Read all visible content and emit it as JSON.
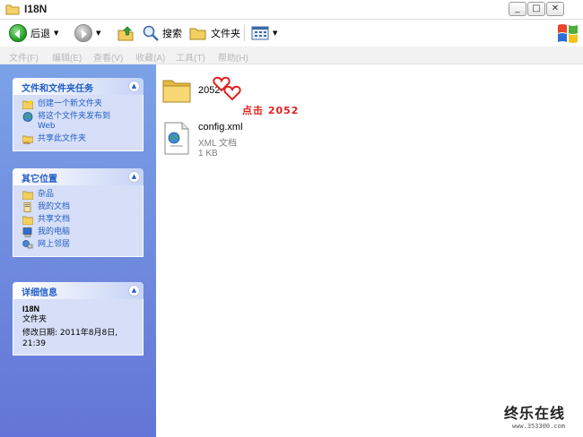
{
  "window": {
    "title": "I18N",
    "controls": {
      "minimize": "_",
      "maximize": "□",
      "close": "✕"
    }
  },
  "toolbar": {
    "back_label": "后退",
    "search_label": "搜索",
    "folders_label": "文件夹"
  },
  "menu": {
    "items": [
      "文件(F)",
      "编辑(E)",
      "查看(V)",
      "收藏(A)",
      "工具(T)",
      "帮助(H)"
    ]
  },
  "left_pane": {
    "tasks": {
      "title": "文件和文件夹任务",
      "items": [
        {
          "icon": "new-folder-icon",
          "label": "创建一个新文件夹"
        },
        {
          "icon": "globe-publish-icon",
          "label": "将这个文件夹发布到",
          "label2": "Web"
        },
        {
          "icon": "share-folder-icon",
          "label": "共享此文件夹"
        }
      ]
    },
    "places": {
      "title": "其它位置",
      "items": [
        {
          "icon": "folder-icon",
          "label": "杂品"
        },
        {
          "icon": "my-documents-icon",
          "label": "我的文档"
        },
        {
          "icon": "shared-documents-icon",
          "label": "共享文档"
        },
        {
          "icon": "my-computer-icon",
          "label": "我的电脑"
        },
        {
          "icon": "network-places-icon",
          "label": "网上邻居"
        }
      ]
    },
    "details": {
      "title": "详细信息",
      "name": "I18N",
      "type": "文件夹",
      "modified_line1": "修改日期: 2011年8月8日,",
      "modified_line2": "21:39"
    }
  },
  "content": {
    "folder": {
      "name": "2052"
    },
    "annotation": "点击 2052",
    "file": {
      "name": "config.xml",
      "type": "XML 文档",
      "size": "1 KB"
    }
  },
  "watermark": {
    "main": "终乐在线",
    "url": "www.353300.com"
  },
  "colors": {
    "left_pane_top": "#7ba2e7",
    "left_pane_bottom": "#6375d6",
    "panel_title": "#215dc6",
    "panel_body": "#d6dff7",
    "annotation": "#e0201d"
  }
}
